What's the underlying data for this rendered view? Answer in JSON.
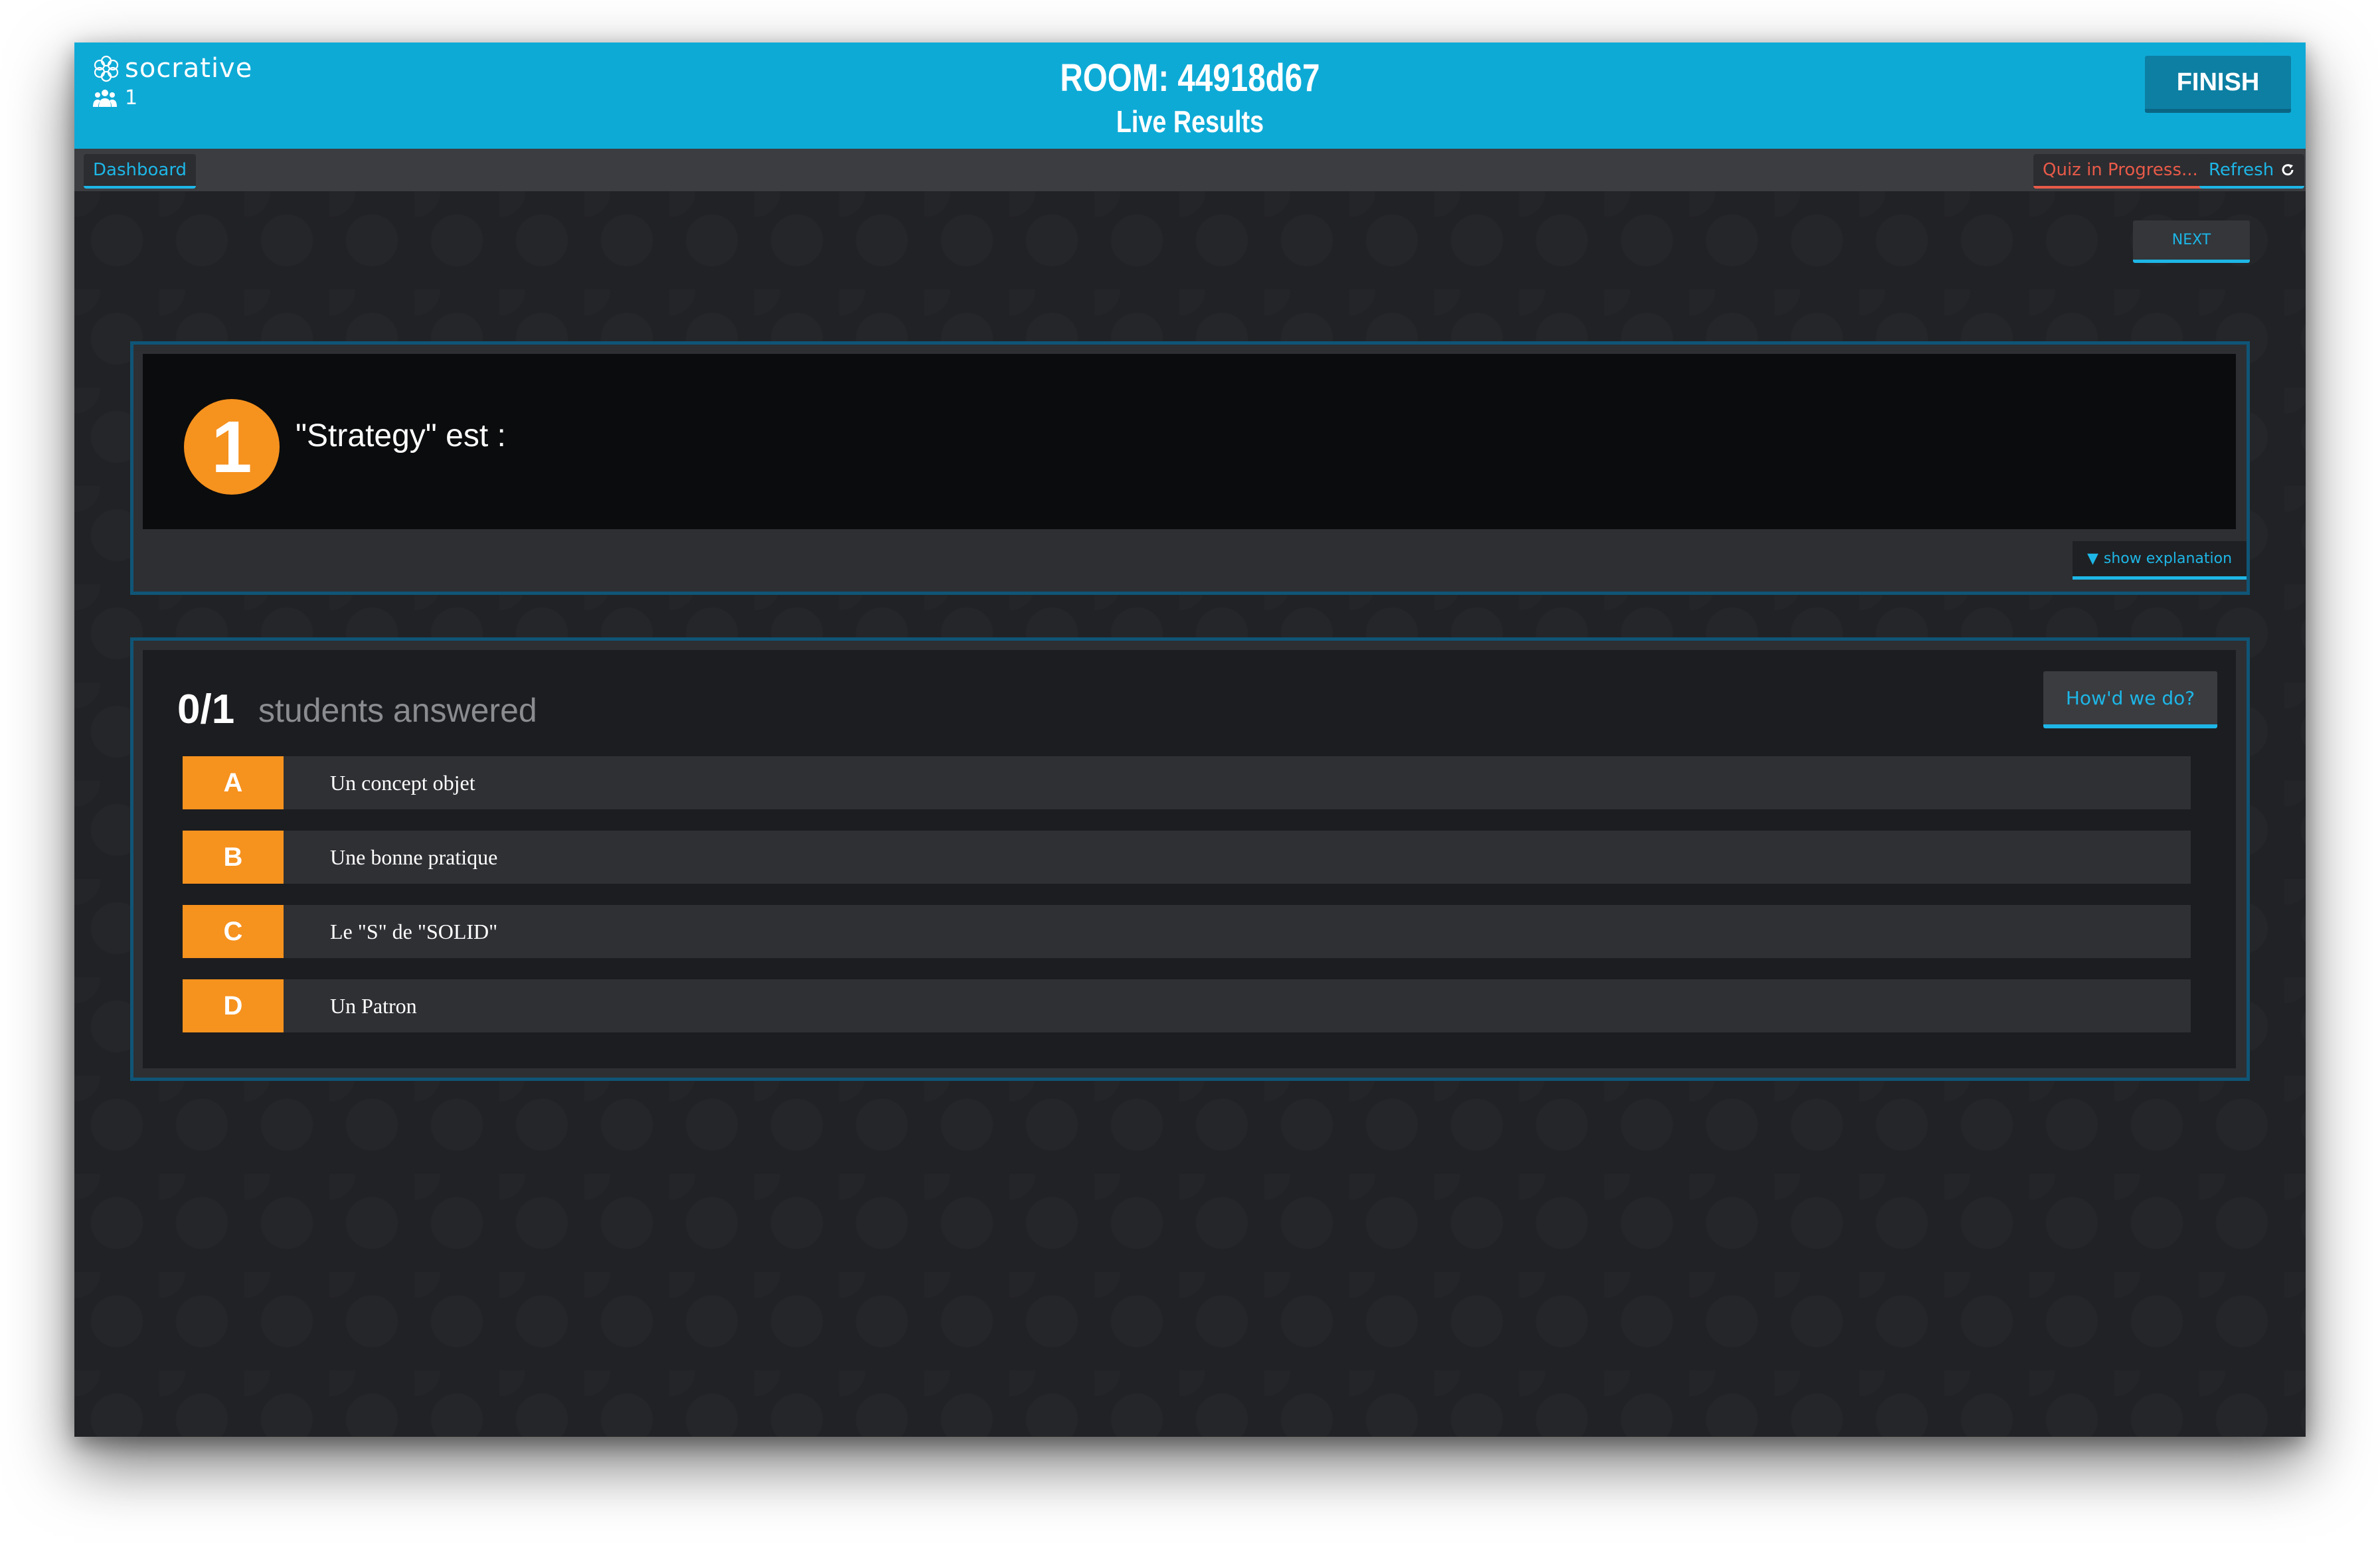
{
  "header": {
    "logo_text": "socrative",
    "student_count": "1",
    "room_title": "ROOM: 44918d67",
    "subtitle": "Live Results",
    "finish_label": "FINISH"
  },
  "toolbar": {
    "dashboard_label": "Dashboard",
    "quiz_status_label": "Quiz in Progress...",
    "refresh_label": "Refresh"
  },
  "navigation": {
    "next_label": "NEXT"
  },
  "question": {
    "number": "1",
    "text": "\"Strategy\" est :",
    "explanation_toggle_label": "show explanation"
  },
  "results": {
    "answered_count": "0/1",
    "answered_label": "students answered",
    "howd_we_do_label": "How'd we do?",
    "answers": [
      {
        "letter": "A",
        "text": "Un concept objet"
      },
      {
        "letter": "B",
        "text": "Une bonne pratique"
      },
      {
        "letter": "C",
        "text": "Le \"S\" de \"SOLID\""
      },
      {
        "letter": "D",
        "text": "Un Patron"
      }
    ]
  },
  "colors": {
    "header_bg": "#0eaad6",
    "accent": "#1eb6e6",
    "warning": "#e85a48",
    "answer_letter_bg": "#f6921e",
    "panel_border": "#0f5577"
  },
  "icons": {
    "logo": "socrative-logo-icon",
    "students": "people-icon",
    "refresh": "refresh-icon",
    "explanation_toggle": "triangle-down-icon"
  }
}
